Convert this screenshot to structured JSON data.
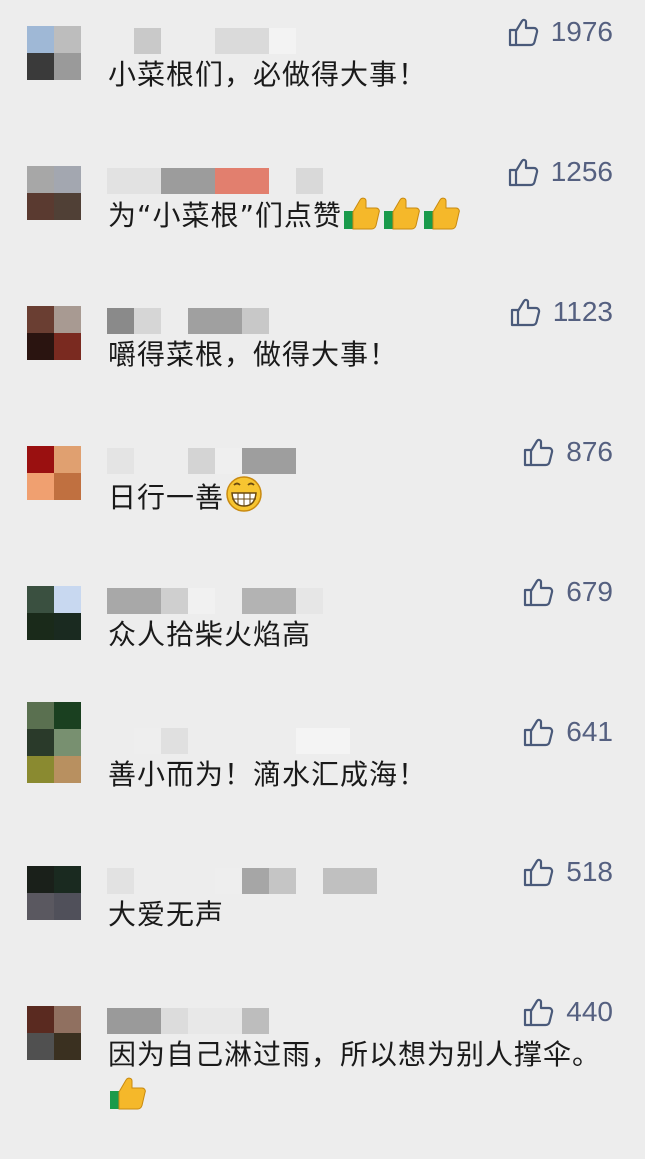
{
  "comments": [
    {
      "text": "小菜根们，必做得大事！",
      "likes": "1976",
      "avatar_colors": [
        "#9fb8d6",
        "#bdbdbd",
        "#3a3a3a",
        "#9a9a9a"
      ],
      "emojis": []
    },
    {
      "text": "为“小菜根”们点赞",
      "likes": "1256",
      "avatar_colors": [
        "#a7a7a7",
        "#a3a7b0",
        "#5a3a30",
        "#504036"
      ],
      "emojis": [
        "thumbs-up",
        "thumbs-up",
        "thumbs-up"
      ]
    },
    {
      "text": "嚼得菜根，做得大事！",
      "likes": "1123",
      "avatar_colors": [
        "#6a3e32",
        "#a89a92",
        "#2a1410",
        "#7a2a20"
      ],
      "emojis": []
    },
    {
      "text": "日行一善",
      "likes": "876",
      "avatar_colors": [
        "#9a1010",
        "#e0a070",
        "#f0a070",
        "#c07040"
      ],
      "emojis": [
        "grinning-face"
      ]
    },
    {
      "text": "众人拾柴火焰高",
      "likes": "679",
      "avatar_colors": [
        "#3a5040",
        "#c8d8f0",
        "#1a2a1a",
        "#1a2a20"
      ],
      "emojis": []
    },
    {
      "text": "善小而为！滴水汇成海！",
      "likes": "641",
      "avatar_colors": [
        "#5a7050",
        "#1a4020",
        "#2a3a2a",
        "#789070",
        "#8a8a30",
        "#b89060"
      ],
      "emojis": []
    },
    {
      "text": "大爱无声",
      "likes": "518",
      "avatar_colors": [
        "#1a201a",
        "#1a2a20",
        "#5a5860",
        "#50505a"
      ],
      "emojis": []
    },
    {
      "text": "因为自己淋过雨，所以想为别人撑伞。",
      "likes": "440",
      "avatar_colors": [
        "#5a2a20",
        "#907060",
        "#505050",
        "#3a3020"
      ],
      "emojis": [
        "thumbs-up"
      ]
    }
  ]
}
